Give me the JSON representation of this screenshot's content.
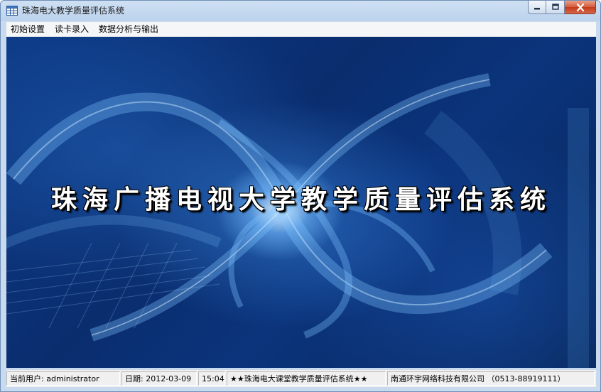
{
  "window": {
    "title": "珠海电大教学质量评估系统"
  },
  "menu": {
    "items": [
      "初始设置",
      "读卡录入",
      "数据分析与输出"
    ]
  },
  "banner": {
    "text": "珠海广播电视大学教学质量评估系统"
  },
  "status": {
    "user_label": "当前用户:",
    "user_value": "administrator",
    "date_label": "日期:",
    "date_value": "2012-03-09",
    "time_value": "15:04",
    "system_text": "★★珠海电大课堂教学质量评估系统★★",
    "company_text": "南通环宇网络科技有限公司",
    "phone_text": "（0513-88919111）"
  },
  "colors": {
    "background_blue": "#0b347c",
    "close_red": "#c03b1b"
  },
  "icons": [
    "app-grid-icon",
    "minimize-icon",
    "maximize-icon",
    "close-icon"
  ]
}
